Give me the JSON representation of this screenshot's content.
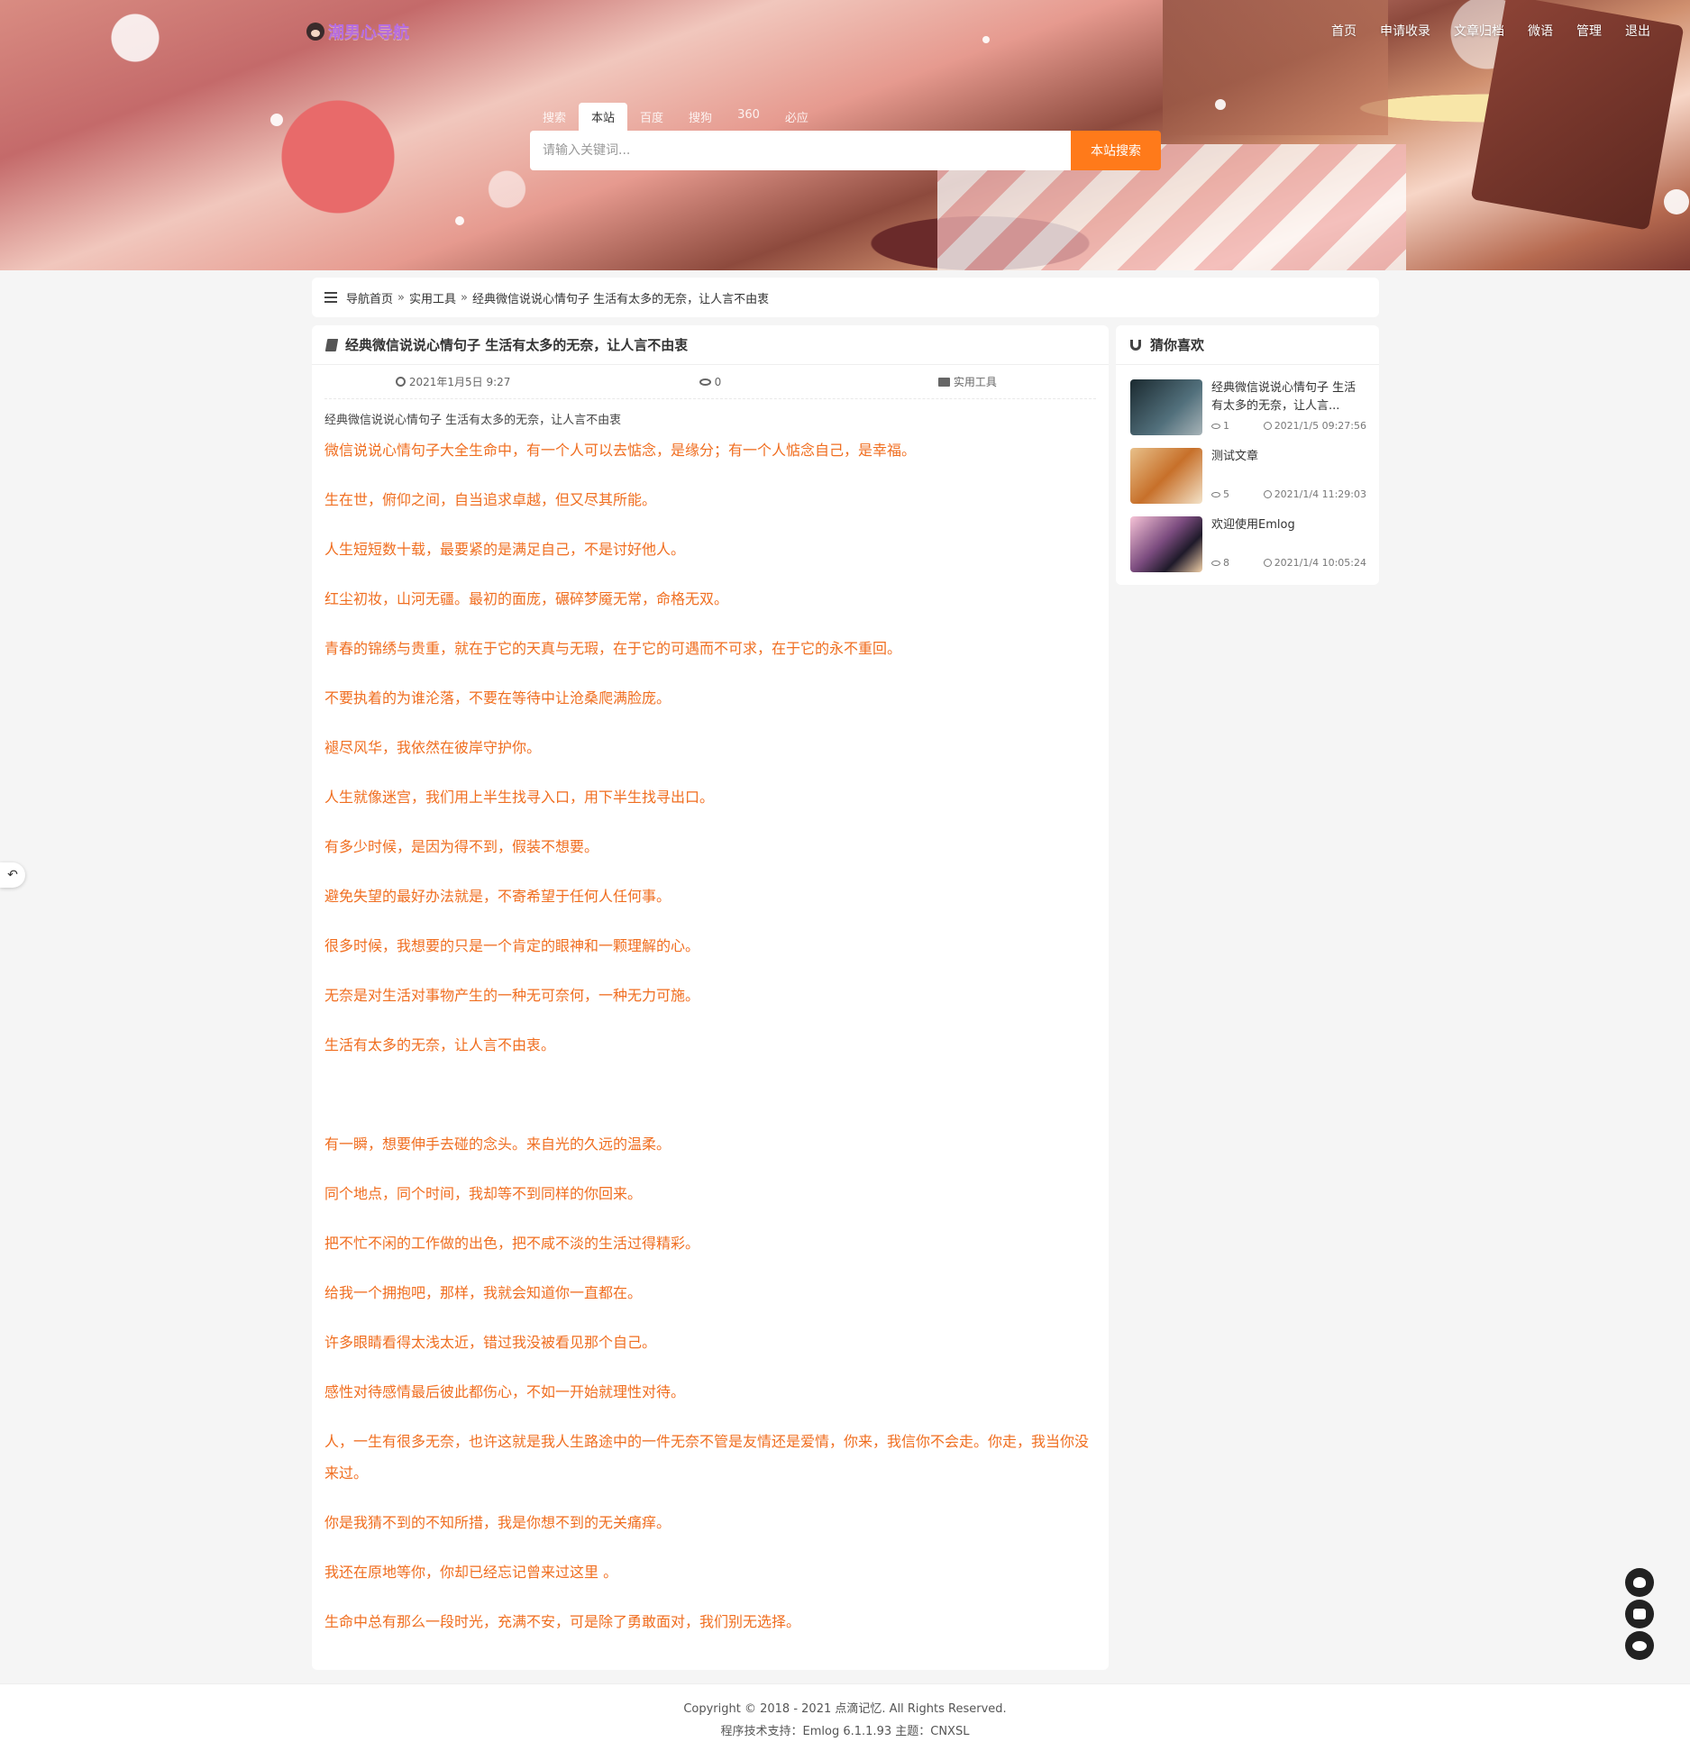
{
  "site": {
    "logo_text": "潮男心导航"
  },
  "topnav": [
    "首页",
    "申请收录",
    "文章归档",
    "微语",
    "管理",
    "退出"
  ],
  "search": {
    "tabs": [
      "搜索",
      "本站",
      "百度",
      "搜狗",
      "360",
      "必应"
    ],
    "active_tab": "本站",
    "placeholder": "请输入关键词...",
    "button": "本站搜索"
  },
  "breadcrumb": {
    "home": "导航首页",
    "sep": "»",
    "category": "实用工具",
    "current": "经典微信说说心情句子 生活有太多的无奈，让人言不由衷"
  },
  "article": {
    "title": "经典微信说说心情句子 生活有太多的无奈，让人言不由衷",
    "date": "2021年1月5日 9:27",
    "views": "0",
    "category": "实用工具",
    "summary": "经典微信说说心情句子 生活有太多的无奈，让人言不由衷",
    "paragraphs": [
      "微信说说心情句子大全生命中，有一个人可以去惦念，是缘分；有一个人惦念自己，是幸福。",
      "生在世，俯仰之间，自当追求卓越，但又尽其所能。",
      "人生短短数十载，最要紧的是满足自己，不是讨好他人。",
      "红尘初妆，山河无疆。最初的面庞，碾碎梦魇无常，命格无双。",
      "青春的锦绣与贵重，就在于它的天真与无瑕，在于它的可遇而不可求，在于它的永不重回。",
      "不要执着的为谁沦落，不要在等待中让沧桑爬满脸庞。",
      "褪尽风华，我依然在彼岸守护你。",
      "人生就像迷宫，我们用上半生找寻入口，用下半生找寻出口。",
      "有多少时候，是因为得不到，假装不想要。",
      "避免失望的最好办法就是，不寄希望于任何人任何事。",
      "很多时候，我想要的只是一个肯定的眼神和一颗理解的心。",
      "无奈是对生活对事物产生的一种无可奈何，一种无力可施。",
      "生活有太多的无奈，让人言不由衷。",
      "",
      "有一瞬，想要伸手去碰的念头。来自光的久远的温柔。",
      "同个地点，同个时间，我却等不到同样的你回来。",
      "把不忙不闲的工作做的出色，把不咸不淡的生活过得精彩。",
      "给我一个拥抱吧，那样，我就会知道你一直都在。",
      "许多眼睛看得太浅太近，错过我没被看见那个自己。",
      "感性对待感情最后彼此都伤心，不如一开始就理性对待。",
      "人，一生有很多无奈，也许这就是我人生路途中的一件无奈不管是友情还是爱情，你来，我信你不会走。你走，我当你没来过。",
      "你是我猜不到的不知所措，我是你想不到的无关痛痒。",
      "我还在原地等你，你却已经忘记曾来过这里 。",
      "生命中总有那么一段时光，充满不安，可是除了勇敢面对，我们别无选择。"
    ]
  },
  "sidebar": {
    "title": "猜你喜欢",
    "items": [
      {
        "title": "经典微信说说心情句子 生活有太多的无奈，让人言...",
        "views": "1",
        "time": "2021/1/5 09:27:56"
      },
      {
        "title": "测试文章",
        "views": "5",
        "time": "2021/1/4 11:29:03"
      },
      {
        "title": "欢迎使用Emlog",
        "views": "8",
        "time": "2021/1/4 10:05:24"
      }
    ]
  },
  "footer": {
    "copyright": "Copyright © 2018 - 2021 点滴记忆. All Rights Reserved.",
    "powered": "程序技术支持：Emlog 6.1.1.93 主题：CNXSL"
  },
  "colors": {
    "accent": "#ff7a1a",
    "content_text": "#f06e20"
  }
}
